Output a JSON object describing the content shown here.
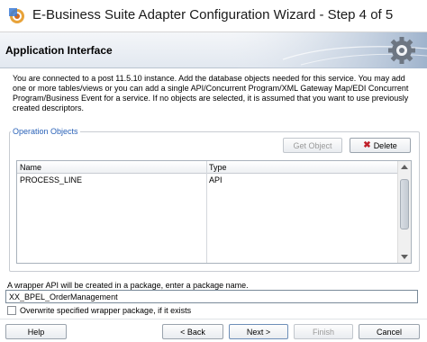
{
  "window": {
    "title": "E-Business Suite Adapter Configuration Wizard - Step 4 of 5"
  },
  "header": {
    "title": "Application Interface",
    "art_icon": "gear-icon"
  },
  "description": "You are connected to a post 11.5.10 instance. Add the database objects needed for this service. You may add one or more tables/views or you can add a single API/Concurrent Program/XML Gateway Map/EDI Concurrent Program/Business Event for a service. If no objects are selected, it is assumed that you want to use previously created descriptors.",
  "operation_objects": {
    "legend": "Operation Objects",
    "get_object_label": "Get Object",
    "delete_label": "Delete",
    "columns": [
      "Name",
      "Type"
    ],
    "rows": [
      {
        "name": "PROCESS_LINE",
        "type": "API"
      }
    ]
  },
  "wrapper": {
    "label": "A wrapper API will be created in a package, enter a package name.",
    "package_value": "XX_BPEL_OrderManagement",
    "overwrite_label": "Overwrite specified wrapper package, if it exists",
    "overwrite_checked": false
  },
  "footer": {
    "help_label": "Help",
    "back_label": "< Back",
    "next_label": "Next >",
    "finish_label": "Finish",
    "cancel_label": "Cancel"
  },
  "colors": {
    "legend": "#2a62b8",
    "delete_icon": "#c0202a",
    "header_bg": "#e2e8f0"
  }
}
